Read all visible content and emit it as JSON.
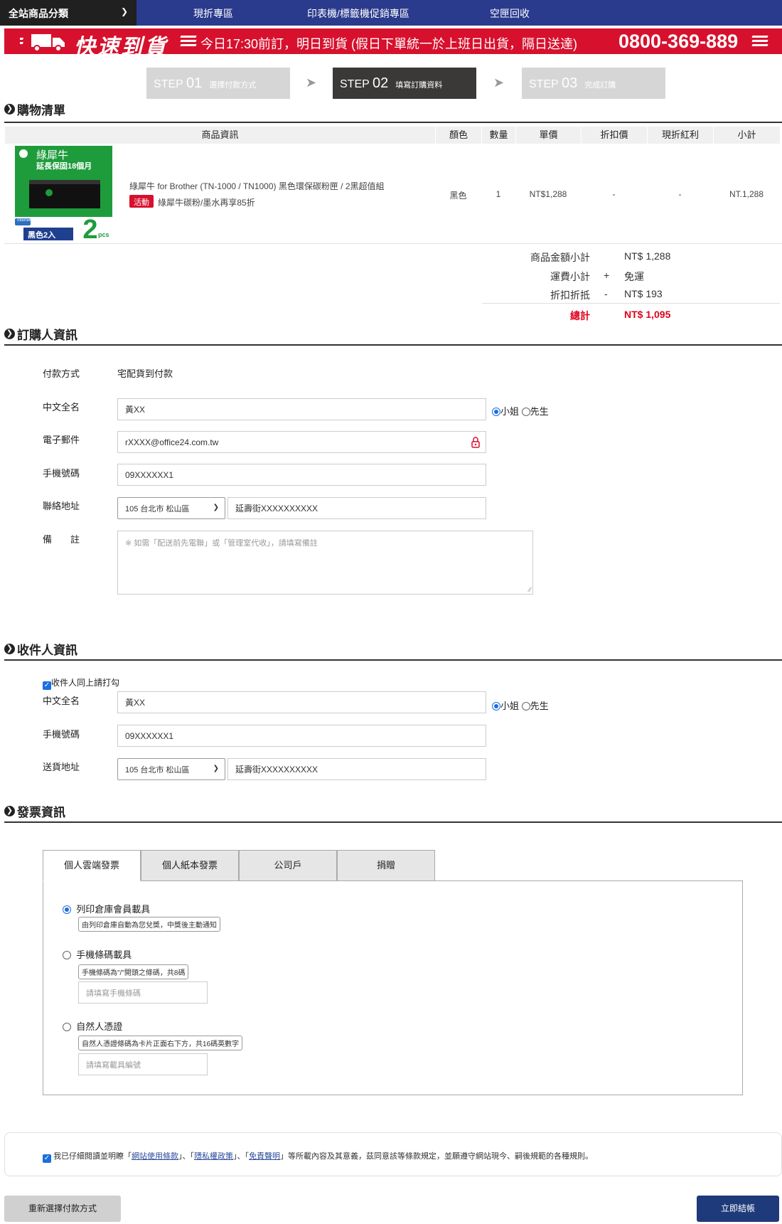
{
  "nav": {
    "category_label": "全站商品分類",
    "links": [
      "現折專區",
      "印表機/標籤機促銷專區",
      "空匣回收"
    ]
  },
  "banner": {
    "headline": "快速到貨",
    "message": "今日17:30前訂，明日到貨 (假日下單統一於上班日出貨，隔日送達)",
    "phone": "0800-369-889"
  },
  "steps": [
    {
      "num": "01",
      "prefix": "STEP",
      "label": "選擇付款方式"
    },
    {
      "num": "02",
      "prefix": "STEP",
      "label": "填寫訂購資料"
    },
    {
      "num": "03",
      "prefix": "STEP",
      "label": "完成訂購"
    }
  ],
  "cart": {
    "title": "購物清單",
    "headers": [
      "商品資訊",
      "顏色",
      "數量",
      "單價",
      "折扣價",
      "現折紅利",
      "小計"
    ],
    "item": {
      "image_brand": "綠犀牛",
      "image_warranty": "延長保固18個月",
      "image_cert": "Intertek",
      "image_pack": "黑色2入",
      "image_qty": "2",
      "image_unit": "pcs",
      "name": "綠犀牛 for Brother (TN-1000 / TN1000) 黑色環保碳粉匣 / 2黑超值組",
      "badge": "活動",
      "promo": "綠犀牛碳粉/墨水再享85折",
      "color": "黑色",
      "qty": "1",
      "price": "NT$1,288",
      "discount": "-",
      "bonus": "-",
      "subtotal": "NT.1,288"
    },
    "summary": {
      "goods_label": "商品金額小計",
      "goods_value": "NT$ 1,288",
      "shipping_label": "運費小計",
      "shipping_sign": "+",
      "shipping_value": "免運",
      "deduct_label": "折扣折抵",
      "deduct_sign": "-",
      "deduct_value": "NT$ 193",
      "total_label": "總計",
      "total_value": "NT$ 1,095"
    }
  },
  "buyer": {
    "title": "訂購人資訊",
    "payment_label": "付款方式",
    "payment_value": "宅配貨到付款",
    "name_label": "中文全名",
    "name_value": "黃XX",
    "miss": "小姐",
    "mr": "先生",
    "email_label": "電子郵件",
    "email_value": "rXXXX@office24.com.tw",
    "phone_label": "手機號碼",
    "phone_value": "09XXXXXX1",
    "addr_label": "聯絡地址",
    "addr_select": "105 台北市 松山區",
    "addr_value": "延壽街XXXXXXXXXX",
    "note_label": "備　　註",
    "note_placeholder": "※ 如需「配送前先電聯」或「管理室代收」，請填寫備註"
  },
  "receiver": {
    "title": "收件人資訊",
    "same_label": "收件人同上請打勾",
    "name_label": "中文全名",
    "name_value": "黃XX",
    "miss": "小姐",
    "mr": "先生",
    "phone_label": "手機號碼",
    "phone_value": "09XXXXXX1",
    "addr_label": "送貨地址",
    "addr_select": "105 台北市 松山區",
    "addr_value": "延壽街XXXXXXXXXX"
  },
  "invoice": {
    "title": "發票資訊",
    "tabs": [
      "個人雲端發票",
      "個人紙本發票",
      "公司戶",
      "捐贈"
    ],
    "opt1_label": "列印倉庫會員載具",
    "opt1_hint": "由列印倉庫自動為您兌獎，中獎後主動通知",
    "opt2_label": "手機條碼載具",
    "opt2_hint": "手機條碼為\"/\"開頭之條碼，共8碼",
    "opt2_placeholder": "請填寫手機條碼",
    "opt3_label": "自然人憑證",
    "opt3_hint": "自然人憑證條碼為卡片正面右下方，共16碼英數字",
    "opt3_placeholder": "請填寫載具編號"
  },
  "agree": {
    "prefix": "我已仔細閱讀並明瞭「",
    "link1": "網站使用條款",
    "mid1": "」、「",
    "link2": "隱私權政策",
    "mid2": "」、「",
    "link3": "免責聲明",
    "suffix": "」等所載內容及其意義，茲同意該等條款規定，並願遵守網站現今、嗣後規範的各種規則。"
  },
  "buttons": {
    "back": "重新選擇付款方式",
    "submit": "立即結帳"
  },
  "colors": {
    "nav": "#2a3a8c",
    "banner": "#d7112d",
    "total": "#e0001a",
    "submit": "#1e3a7a"
  }
}
